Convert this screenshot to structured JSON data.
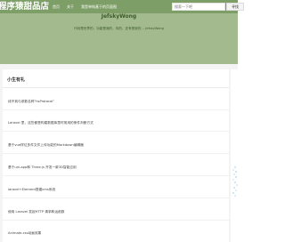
{
  "header": {
    "logo": "程序猿甜品店",
    "nav": [
      "首页",
      "关于",
      "我是单纯基于的页面图"
    ],
    "search_placeholder": "搜索一下吧",
    "search_button": "寻找"
  },
  "hero": {
    "title": "JefskyWong",
    "subtitle": "代码是世界的，功能是我的，你的，还有是我的 -- JefskyWong"
  },
  "section": {
    "title": "小生有礼",
    "links": [
      "线不到与参数名称\"hsProtocol\"",
      "Laravel 里，这些都是构建数据库里时常用的条件判断方式",
      "基于vue样位多件文件上传功能的Markdown编辑器",
      "基于uni-app和 Three.js 开发一款3D智能应用",
      "laravel+Element搭建cms系统",
      "使用 Laravel 发起HTTP 请求和运函数",
      "Animate.css动画效果"
    ]
  }
}
